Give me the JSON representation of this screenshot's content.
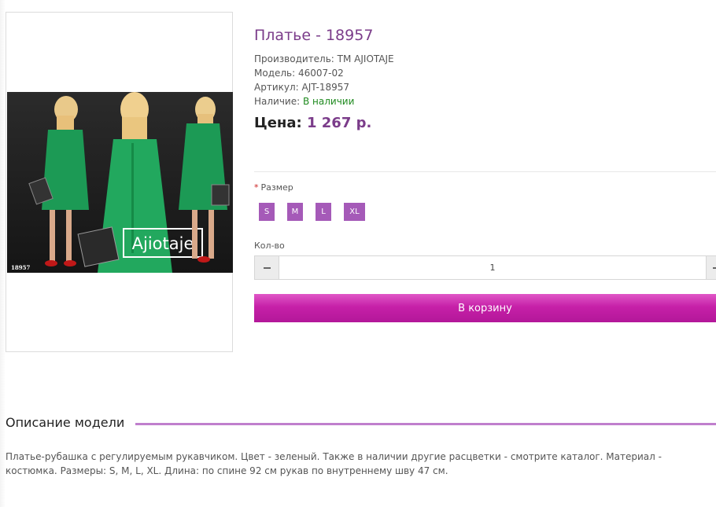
{
  "product": {
    "title": "Платье - 18957",
    "specs": [
      {
        "label": "Производитель:",
        "value": "TM AJIOTAJE"
      },
      {
        "label": "Модель:",
        "value": "46007-02"
      },
      {
        "label": "Артикул:",
        "value": "AJT-18957"
      },
      {
        "label": "Наличие:",
        "value": "В наличии"
      }
    ],
    "price_label": "Цена:",
    "price_value": "1 267 р.",
    "image": {
      "brand_text": "Ajiotaje",
      "code_text": "18957"
    }
  },
  "options": {
    "size_required_mark": "*",
    "size_label": "Размер",
    "sizes": [
      "S",
      "M",
      "L",
      "XL"
    ]
  },
  "quantity": {
    "label": "Кол-во",
    "value": "1"
  },
  "cart": {
    "button_label": "В корзину"
  },
  "description": {
    "title": "Описание модели",
    "text": "Платье-рубашка с регулируемым рукавчиком. Цвет - зеленый. Также в наличии другие расцветки - смотрите каталог. Материал - костюмка. Размеры: S, M, L, XL. Длина: по спине 92 см рукав по внутреннему шву 47 см."
  },
  "colors": {
    "accent": "#7b3c8a",
    "size_button": "#a55ab8",
    "cart_button": "#c620a8",
    "in_stock": "#1f8a1f",
    "dress": "#1fa05a"
  }
}
